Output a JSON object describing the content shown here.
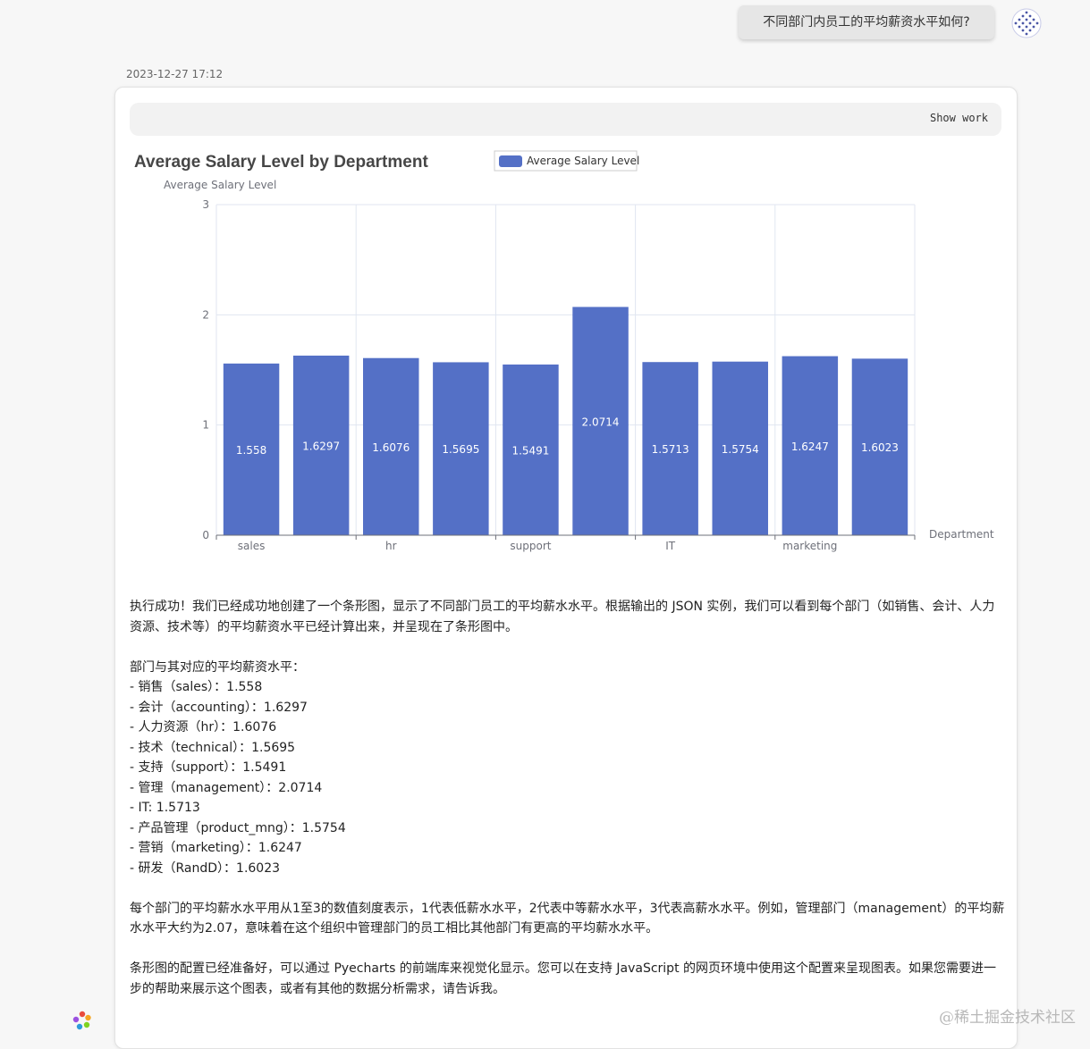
{
  "user_message": "不同部门内员工的平均薪资水平如何?",
  "timestamp": "2023-12-27 17:12",
  "show_work_label": "Show work",
  "colors": {
    "bar": "#5470c6",
    "grid": "#e0e6f1",
    "axis": "#6e7079",
    "title": "#464646"
  },
  "chart_data": {
    "type": "bar",
    "title": "Average Salary Level by Department",
    "ylabel": "Average Salary Level",
    "xlabel": "Department",
    "legend": "Average Salary Level",
    "legend_position": "top",
    "ylim": [
      0,
      3
    ],
    "yticks": [
      "0",
      "1",
      "2",
      "3"
    ],
    "grid": true,
    "categories": [
      "sales",
      "accounting",
      "hr",
      "technical",
      "support",
      "management",
      "IT",
      "product_mng",
      "marketing",
      "RandD"
    ],
    "visible_xtick_labels": [
      "sales",
      "",
      "hr",
      "",
      "support",
      "",
      "IT",
      "",
      "marketing",
      ""
    ],
    "values": [
      1.558,
      1.6297,
      1.6076,
      1.5695,
      1.5491,
      2.0714,
      1.5713,
      1.5754,
      1.6247,
      1.6023
    ]
  },
  "answer": {
    "p1": "执行成功！我们已经成功地创建了一个条形图，显示了不同部门员工的平均薪水水平。根据输出的 JSON 实例，我们可以看到每个部门（如销售、会计、人力资源、技术等）的平均薪资水平已经计算出来，并呈现在了条形图中。",
    "list_header": "部门与其对应的平均薪资水平：",
    "list": [
      "- 销售（sales）：1.558",
      "- 会计（accounting）：1.6297",
      "- 人力资源（hr）：1.6076",
      "- 技术（technical）：1.5695",
      "- 支持（support）：1.5491",
      "- 管理（management）：2.0714",
      "- IT: 1.5713",
      "- 产品管理（product_mng）：1.5754",
      "- 营销（marketing）：1.6247",
      "- 研发（RandD）：1.6023"
    ],
    "p2": "每个部门的平均薪水水平用从1至3的数值刻度表示，1代表低薪水水平，2代表中等薪水水平，3代表高薪水水平。例如，管理部门（management）的平均薪水水平大约为2.07，意味着在这个组织中管理部门的员工相比其他部门有更高的平均薪水水平。",
    "p3": "条形图的配置已经准备好，可以通过 Pyecharts 的前端库来视觉化显示。您可以在支持 JavaScript 的网页环境中使用这个配置来呈现图表。如果您需要进一步的帮助来展示这个图表，或者有其他的数据分析需求，请告诉我。"
  },
  "watermark": "@稀土掘金技术社区"
}
